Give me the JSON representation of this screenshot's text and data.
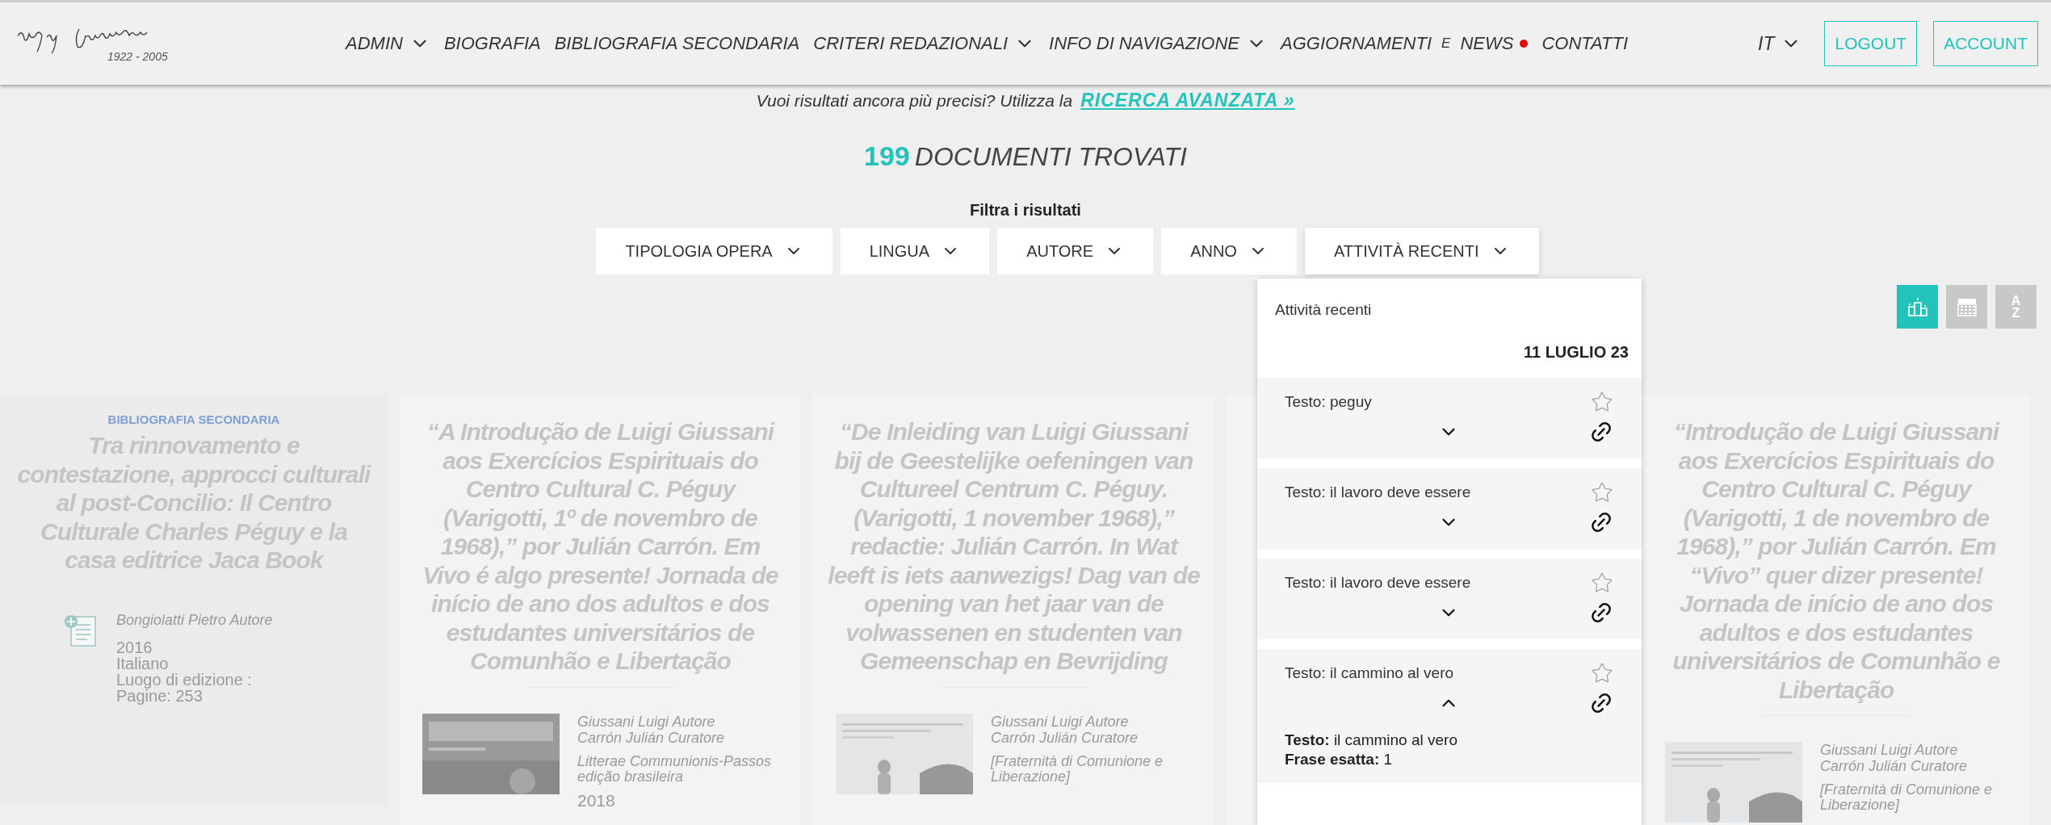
{
  "header": {
    "logo": {
      "years": "1922 - 2005"
    },
    "nav": [
      {
        "parts": [
          "ADMIN"
        ],
        "has_dropdown": true,
        "notification": false
      },
      {
        "parts": [
          "BIOGRAFIA"
        ],
        "has_dropdown": false,
        "notification": false
      },
      {
        "parts": [
          "BIBLIOGRAFIA SECONDARIA"
        ],
        "has_dropdown": false,
        "notification": false
      },
      {
        "parts": [
          "CRITERI REDAZIONALI"
        ],
        "has_dropdown": true,
        "notification": false
      },
      {
        "parts": [
          "INFO DI NAVIGAZIONE"
        ],
        "has_dropdown": true,
        "notification": false
      },
      {
        "parts": [
          "AGGIORNAMENTI",
          "E",
          "NEWS"
        ],
        "has_dropdown": false,
        "notification": true
      },
      {
        "parts": [
          "CONTATTI"
        ],
        "has_dropdown": false,
        "notification": false
      }
    ],
    "language": "IT",
    "buttons": [
      "LOGOUT",
      "ACCOUNT"
    ]
  },
  "search_hint": {
    "text": "Vuoi risultati ancora più precisi? Utilizza la",
    "link": "RICERCA AVANZATA »"
  },
  "results": {
    "count": "199",
    "label": "DOCUMENTI TROVATI"
  },
  "filters": {
    "title": "Filtra i risultati",
    "items": [
      {
        "label": "TIPOLOGIA OPERA",
        "expanded": false
      },
      {
        "label": "LINGUA",
        "expanded": false
      },
      {
        "label": "AUTORE",
        "expanded": false
      },
      {
        "label": "ANNO",
        "expanded": false
      },
      {
        "label": "ATTIVITÀ RECENTI",
        "expanded": true
      }
    ]
  },
  "recent_activity": {
    "title": "Attività recenti",
    "date": "11 LUGLIO 23",
    "entries": [
      {
        "label": "Testo: peguy",
        "starred": false,
        "expanded": false
      },
      {
        "label": "Testo: il lavoro deve essere",
        "starred": false,
        "expanded": false
      },
      {
        "label": "Testo: il lavoro deve essere",
        "starred": false,
        "expanded": false
      },
      {
        "label": "Testo: il cammino al vero",
        "starred": false,
        "expanded": true,
        "details": [
          {
            "key": "Testo:",
            "value": "il cammino al vero"
          },
          {
            "key": "Frase esatta:",
            "value": "1"
          }
        ]
      }
    ]
  },
  "view_buttons": [
    {
      "kind": "relevance",
      "selected": true
    },
    {
      "kind": "calendar",
      "selected": false
    },
    {
      "kind": "alphabetical",
      "letters": [
        "A",
        "Z"
      ],
      "selected": false
    }
  ],
  "cards": [
    {
      "kind": "note",
      "category": "BIBLIOGRAFIA SECONDARIA",
      "title": "Tra rinnovamento e contestazione, approcci culturali al post-Concilio: Il Centro Culturale Charles Péguy e la casa editrice Jaca Book",
      "authors": [
        "Bongiolatti Pietro Autore"
      ],
      "details": [
        "2016",
        "Italiano",
        "Luogo di edizione :",
        "Pagine: 253"
      ]
    },
    {
      "kind": "book",
      "title": "“A Introdução de Luigi Giussani aos Exercícios Espirituais do Centro Cultural C. Péguy (Varigotti, 1º de novembro de 1968),” por Julián Carrón. Em Vivo é algo presente! Jornada de início de ano dos adultos e dos estudantes universitários de Comunhão e Libertação",
      "authors": [
        "Giussani Luigi Autore",
        "Carrón Julián Curatore"
      ],
      "publisher": "Litterae Communionis-Passos edição brasileira",
      "year": "2018"
    },
    {
      "kind": "book",
      "title": "“De Inleiding van Luigi Giussani bij de Geestelijke oefeningen van Cultureel Centrum C. Péguy. (Varigotti, 1 november 1968),” redactie: Julián Carrón. In Wat leeft is iets aanwezigs! Dag van de opening van het jaar van de volwassenen en studenten van Gemeenschap en Bevrijding",
      "authors": [
        "Giussani Luigi Autore",
        "Carrón Julián Curatore"
      ],
      "publisher": "[Fraternità di Comunione e Liberazione]"
    },
    {
      "kind": "hidden"
    },
    {
      "kind": "book",
      "title": "“Introdução de Luigi Giussani aos Exercícios Espirituais do Centro Cultural C. Péguy (Varigotti, 1 de novembro de 1968),” por Julián Carrón. Em “Vivo” quer dizer presente! Jornada de início de ano dos adultos e dos estudantes universitários de Comunhão e Libertação",
      "authors": [
        "Giussani Luigi Autore",
        "Carrón Julián Curatore"
      ],
      "publisher": "[Fraternità di Comunione e Liberazione]"
    }
  ]
}
